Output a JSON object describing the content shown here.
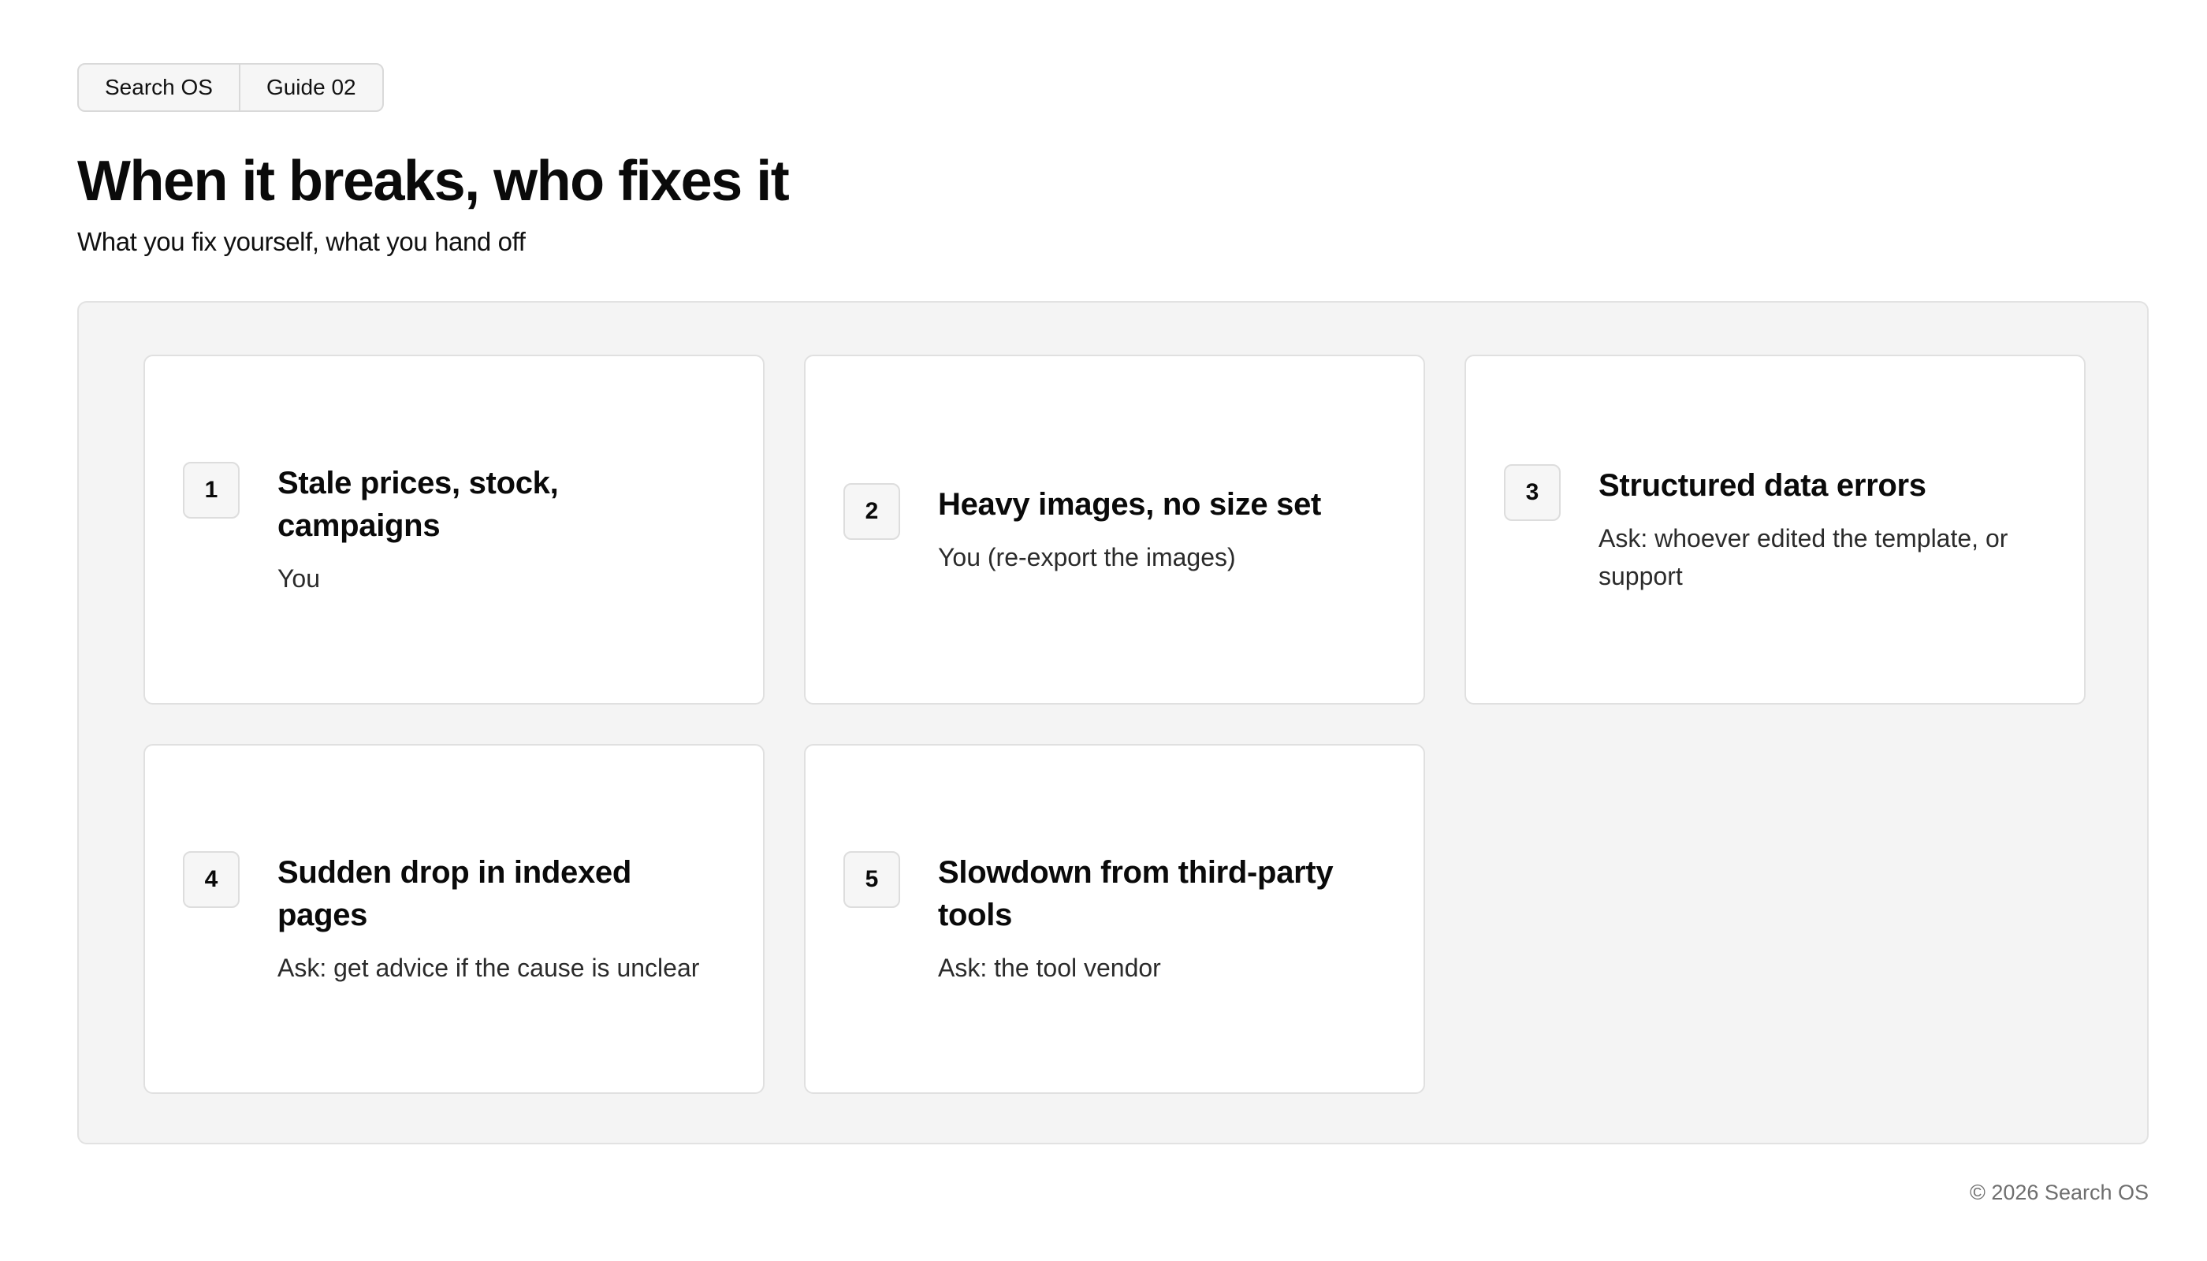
{
  "breadcrumb": {
    "items": [
      "Search OS",
      "Guide 02"
    ]
  },
  "header": {
    "title": "When it breaks, who fixes it",
    "subtitle": "What you fix yourself, what you hand off"
  },
  "cards": [
    {
      "number": "1",
      "title": "Stale prices, stock, campaigns",
      "owner": "You"
    },
    {
      "number": "2",
      "title": "Heavy images, no size set",
      "owner": "You (re-export the images)"
    },
    {
      "number": "3",
      "title": "Structured data errors",
      "owner": "Ask: whoever edited the template, or support"
    },
    {
      "number": "4",
      "title": "Sudden drop in indexed pages",
      "owner": "Ask: get advice if the cause is unclear"
    },
    {
      "number": "5",
      "title": "Slowdown from third-party tools",
      "owner": "Ask: the tool vendor"
    }
  ],
  "footer": {
    "copyright": "© 2026 Search OS"
  }
}
